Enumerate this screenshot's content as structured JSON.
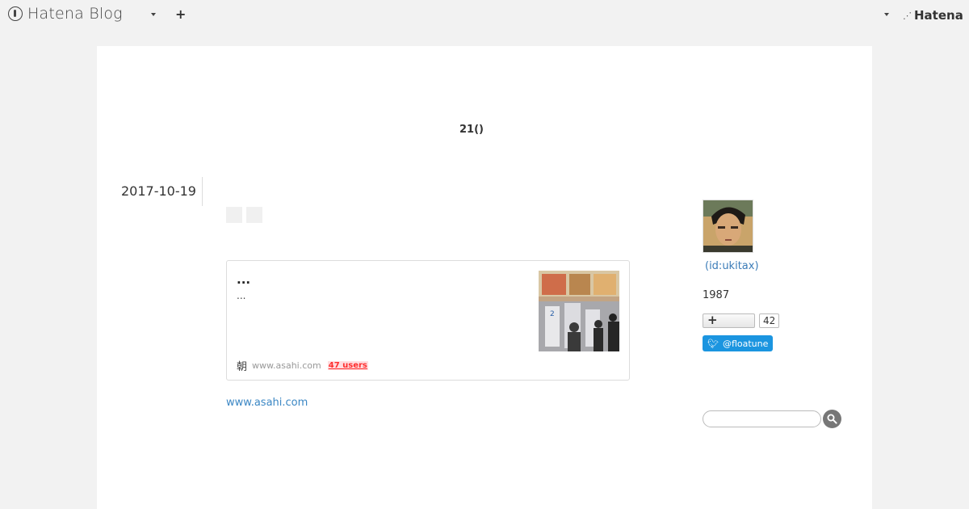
{
  "topbar": {
    "brand": "Hatena Blog",
    "add_icon": "+",
    "hatena_logo": "Hatena"
  },
  "blog": {
    "title": "21()"
  },
  "entry": {
    "date": "2017-10-19",
    "card": {
      "title": "...",
      "description": "...",
      "favicon": "朝",
      "domain": "www.asahi.com",
      "users": "47 users"
    },
    "source_link": "www.asahi.com"
  },
  "sidebar": {
    "user_id": "(id:ukitax)",
    "since": "1987",
    "follow_count": "42",
    "twitter_handle": "@floatune",
    "search_placeholder": ""
  },
  "colors": {
    "link": "#3b87c4",
    "twitter": "#1b95e0",
    "users_badge": "#ff2d2d"
  }
}
